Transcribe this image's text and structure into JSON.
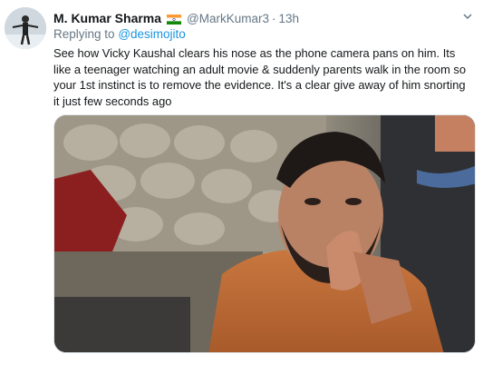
{
  "user": {
    "name": "M. Kumar Sharma",
    "flag": "india-flag",
    "handle": "@MarkKumar3",
    "separator": "·",
    "time": "13h"
  },
  "reply": {
    "prefix": "Replying to",
    "mention": "@desimojito"
  },
  "tweet": {
    "text": "See how Vicky Kaushal clears his nose as the phone camera pans on him. Its like a teenager watching an adult movie & suddenly parents walk in the room so your 1st instinct is to remove the evidence. It's a clear give away of him snorting it just few seconds ago"
  },
  "icons": {
    "menu": "chevron-down-icon"
  },
  "colors": {
    "link": "#1b95e0",
    "muted": "#657786",
    "text": "#14171a"
  }
}
